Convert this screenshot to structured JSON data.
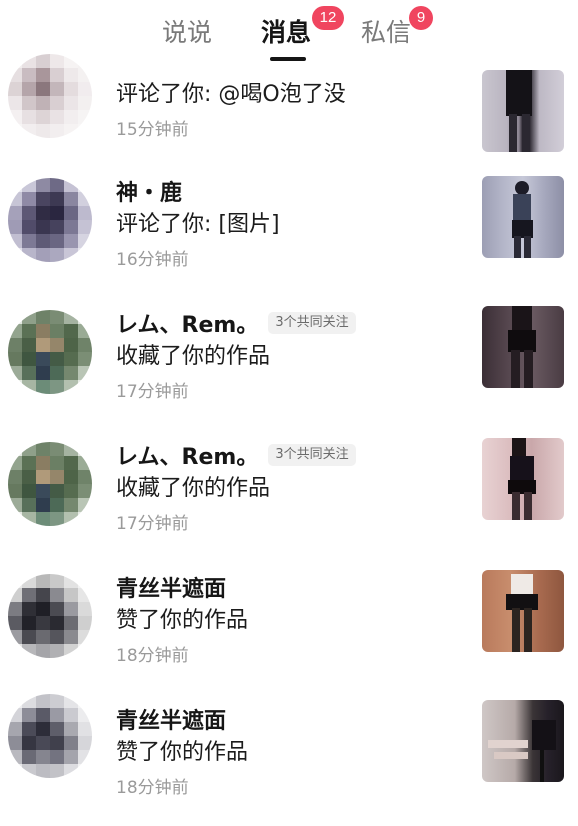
{
  "tabs": {
    "shuoshuo": "说说",
    "xiaoxi": "消息",
    "xiaoxi_badge": "12",
    "sixin": "私信",
    "sixin_badge": "9"
  },
  "notifications": [
    {
      "name": "",
      "mutual": "",
      "action": "评论了你: @喝O泡了没",
      "time": "15分钟前"
    },
    {
      "name": "神・鹿",
      "mutual": "",
      "action": "评论了你: [图片]",
      "time": "16分钟前"
    },
    {
      "name": "レム、Rem。",
      "mutual": "3个共同关注",
      "action": "收藏了你的作品",
      "time": "17分钟前"
    },
    {
      "name": "レム、Rem。",
      "mutual": "3个共同关注",
      "action": "收藏了你的作品",
      "time": "17分钟前"
    },
    {
      "name": "青丝半遮面",
      "mutual": "",
      "action": "赞了你的作品",
      "time": "18分钟前"
    },
    {
      "name": "青丝半遮面",
      "mutual": "",
      "action": "赞了你的作品",
      "time": "18分钟前"
    }
  ]
}
